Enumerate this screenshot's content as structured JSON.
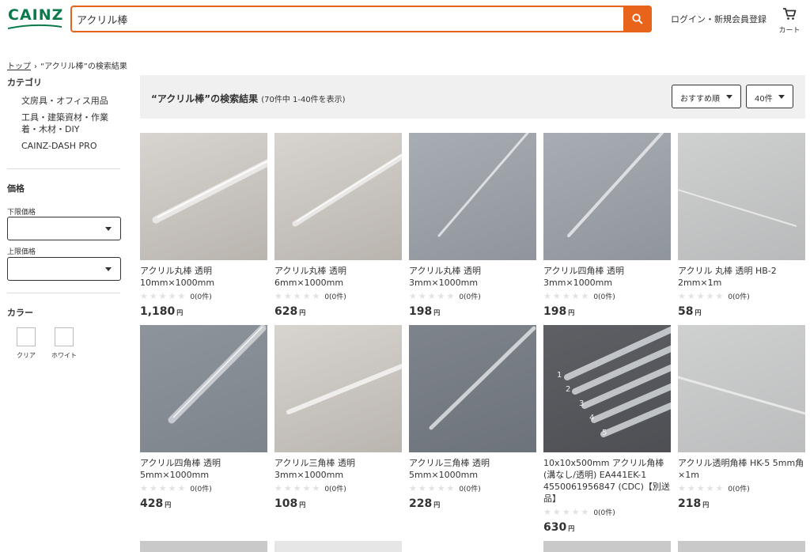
{
  "header": {
    "logo_text": "CAINZ",
    "search_value": "アクリル棒",
    "login_label": "ログイン・新規会員登録",
    "cart_label": "カート",
    "accent_color": "#e8641b",
    "brand_color": "#0a7a4a"
  },
  "breadcrumb": {
    "home": "トップ",
    "separator": "›",
    "current": "“アクリル棒”の検索結果"
  },
  "sidebar": {
    "category_heading": "カテゴリ",
    "categories": [
      "文房具・オフィス用品",
      "工具・建築資材・作業着・木材・DIY",
      "CAINZ-DASH PRO"
    ],
    "price_heading": "価格",
    "price_min_label": "下限価格",
    "price_max_label": "上限価格",
    "color_heading": "カラー",
    "colors": [
      "クリア",
      "ホワイト"
    ]
  },
  "results": {
    "title": "“アクリル棒”の検索結果",
    "count": "(70件中 1-40件を表示)",
    "sort_label": "おすすめ順",
    "per_page_label": "40件"
  },
  "products": [
    {
      "name": "アクリル丸棒 透明 10mm×1000mm",
      "reviews": "0(0件)",
      "price": "1,180",
      "yen": "円"
    },
    {
      "name": "アクリル丸棒 透明 6mm×1000mm",
      "reviews": "0(0件)",
      "price": "628",
      "yen": "円"
    },
    {
      "name": "アクリル丸棒 透明 3mm×1000mm",
      "reviews": "0(0件)",
      "price": "198",
      "yen": "円"
    },
    {
      "name": "アクリル四角棒 透明 3mm×1000mm",
      "reviews": "0(0件)",
      "price": "198",
      "yen": "円"
    },
    {
      "name": "アクリル 丸棒 透明 HB-2 2mm×1m",
      "reviews": "0(0件)",
      "price": "58",
      "yen": "円"
    },
    {
      "name": "アクリル四角棒 透明 5mm×1000mm",
      "reviews": "0(0件)",
      "price": "428",
      "yen": "円"
    },
    {
      "name": "アクリル三角棒 透明 3mm×1000mm",
      "reviews": "0(0件)",
      "price": "108",
      "yen": "円"
    },
    {
      "name": "アクリル三角棒 透明 5mm×1000mm",
      "reviews": "0(0件)",
      "price": "228",
      "yen": "円"
    },
    {
      "name": "10x10x500mm アクリル角棒(溝なし/透明) EA441EK-1 4550061956847 (CDC)【別送品】",
      "reviews": "0(0件)",
      "price": "630",
      "yen": "円"
    },
    {
      "name": "アクリル透明角棒 HK-5 5mm角×1m",
      "reviews": "0(0件)",
      "price": "218",
      "yen": "円"
    }
  ],
  "image_labels": [
    "1",
    "2",
    "3",
    "4",
    "5"
  ]
}
